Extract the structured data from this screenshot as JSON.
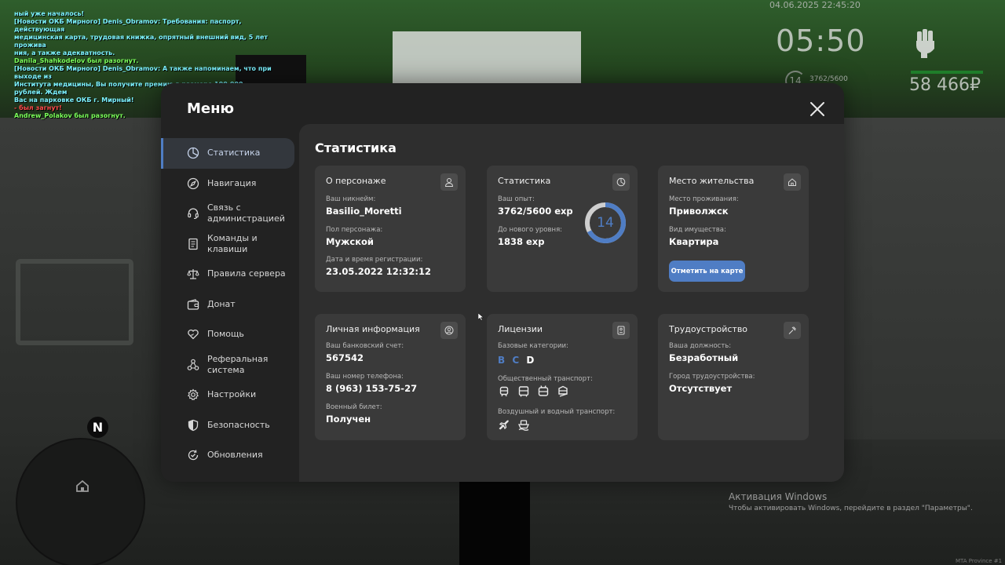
{
  "chat": [
    {
      "text": "ный уже началось!",
      "color": "cyan"
    },
    {
      "text": "[Новости ОКБ Мирного] Denis_Obramov: Требования: паспорт, действующая",
      "color": "cyan"
    },
    {
      "text": "медицинская карта, трудовая книжка, опрятный внешний вид, 5 лет прожива",
      "color": "cyan"
    },
    {
      "text": "ния, а также адекватность.",
      "color": "cyan"
    },
    {
      "text": "Danila_Shahkodelov был разогнут.",
      "color": "green"
    },
    {
      "text": "[Новости ОКБ Мирного] Denis_Obramov: А также напоминаем, что при выходе из",
      "color": "cyan"
    },
    {
      "text": " Института медицины, Вы получите премию в размере 100.000 рублей. Ждем",
      "color": "cyan"
    },
    {
      "text": " Вас на парковке ОКБ г. Мирный!",
      "color": "cyan"
    },
    {
      "text": " - был загнут!",
      "color": "red"
    },
    {
      "text": "Andrew_Polakov был разогнут.",
      "color": "green"
    }
  ],
  "hud": {
    "datetime": "04.06.2025 22:45:20",
    "clock": "05:50",
    "level": "14",
    "exp": "3762/5600",
    "money": "58 466₽",
    "fist_icon": "fist-icon"
  },
  "minimap": {
    "north": "N"
  },
  "menu": {
    "title": "Меню",
    "nav": [
      {
        "label": "Статистика",
        "icon": "pie-chart-icon",
        "active": true
      },
      {
        "label": "Навигация",
        "icon": "compass-icon"
      },
      {
        "label": "Связь с администрацией",
        "icon": "headset-icon"
      },
      {
        "label": "Команды и клавиши",
        "icon": "document-icon"
      },
      {
        "label": "Правила сервера",
        "icon": "scales-icon"
      },
      {
        "label": "Донат",
        "icon": "wallet-icon"
      },
      {
        "label": "Помощь",
        "icon": "heart-hands-icon"
      },
      {
        "label": "Реферальная система",
        "icon": "network-icon"
      },
      {
        "label": "Настройки",
        "icon": "gear-icon"
      },
      {
        "label": "Безопасность",
        "icon": "shield-icon"
      },
      {
        "label": "Обновления",
        "icon": "refresh-check-icon"
      }
    ],
    "content_title": "Статистика",
    "cards": {
      "character": {
        "title": "О персонаже",
        "nickname_label": "Ваш никнейм:",
        "nickname": "Basilio_Moretti",
        "gender_label": "Пол персонажа:",
        "gender": "Мужской",
        "reg_label": "Дата и время регистрации:",
        "reg": "23.05.2022 12:32:12"
      },
      "stats": {
        "title": "Статистика",
        "exp_label": "Ваш опыт:",
        "exp": "3762/5600 exp",
        "next_label": "До нового уровня:",
        "next": "1838 exp",
        "level": "14",
        "level_progress": 0.672
      },
      "residence": {
        "title": "Место жительства",
        "place_label": "Место проживания:",
        "place": "Приволжск",
        "property_label": "Вид имущества:",
        "property": "Квартира",
        "map_button": "Отметить на карте"
      },
      "personal": {
        "title": "Личная информация",
        "bank_label": "Ваш банковский счет:",
        "bank": "567542",
        "phone_label": "Ваш номер телефона:",
        "phone": "8 (963) 153-75-27",
        "military_label": "Военный билет:",
        "military": "Получен"
      },
      "licenses": {
        "title": "Лицензии",
        "base_label": "Базовые категории:",
        "categories": [
          {
            "name": "B",
            "active": true
          },
          {
            "name": "C",
            "active": true
          },
          {
            "name": "D",
            "active": false
          }
        ],
        "public_label": "Общественный транспорт:",
        "air_label": "Воздушный и водный транспорт:"
      },
      "employment": {
        "title": "Трудоустройство",
        "position_label": "Ваша должность:",
        "position": "Безработный",
        "city_label": "Город трудоустройства:",
        "city": "Отсутствует"
      }
    }
  },
  "windows": {
    "line1": "Активация Windows",
    "line2": "Чтобы активировать Windows, перейдите в раздел \"Параметры\"."
  },
  "server_tag": "MTA Province #1",
  "colors": {
    "accent": "#4f7dc4",
    "panel": "#222222",
    "card": "#3a3a3a"
  }
}
